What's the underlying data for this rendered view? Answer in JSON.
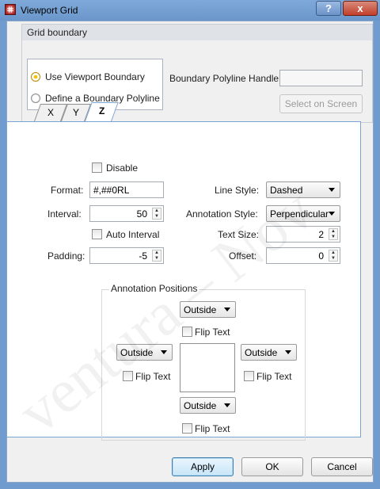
{
  "window": {
    "title": "Viewport Grid",
    "help": "?",
    "close": "x"
  },
  "grid_boundary": {
    "header": "Grid boundary",
    "use_viewport": "Use Viewport Boundary",
    "define_polyline": "Define a Boundary Polyline",
    "selected": "use_viewport",
    "handle_label": "Boundary Polyline Handle",
    "handle_value": "",
    "select_on_screen": "Select on Screen"
  },
  "tabs": [
    {
      "label": "X"
    },
    {
      "label": "Y"
    },
    {
      "label": "Z",
      "active": true
    }
  ],
  "z_tab": {
    "disable_label": "Disable",
    "format_label": "Format:",
    "format_value": "#,##0RL",
    "interval_label": "Interval:",
    "interval_value": "50",
    "auto_interval_label": "Auto Interval",
    "padding_label": "Padding:",
    "padding_value": "-5",
    "line_style_label": "Line Style:",
    "line_style_value": "Dashed",
    "annotation_style_label": "Annotation Style:",
    "annotation_style_value": "Perpendicular",
    "text_size_label": "Text Size:",
    "text_size_value": "2",
    "offset_label": "Offset:",
    "offset_value": "0"
  },
  "annotation_positions": {
    "title": "Annotation Positions",
    "top": {
      "value": "Outside",
      "flip": "Flip Text"
    },
    "left": {
      "value": "Outside",
      "flip": "Flip Text"
    },
    "right": {
      "value": "Outside",
      "flip": "Flip Text"
    },
    "bottom": {
      "value": "Outside",
      "flip": "Flip Text"
    }
  },
  "footer": {
    "apply": "Apply",
    "ok": "OK",
    "cancel": "Cancel"
  },
  "watermark": "ventura – Nov"
}
